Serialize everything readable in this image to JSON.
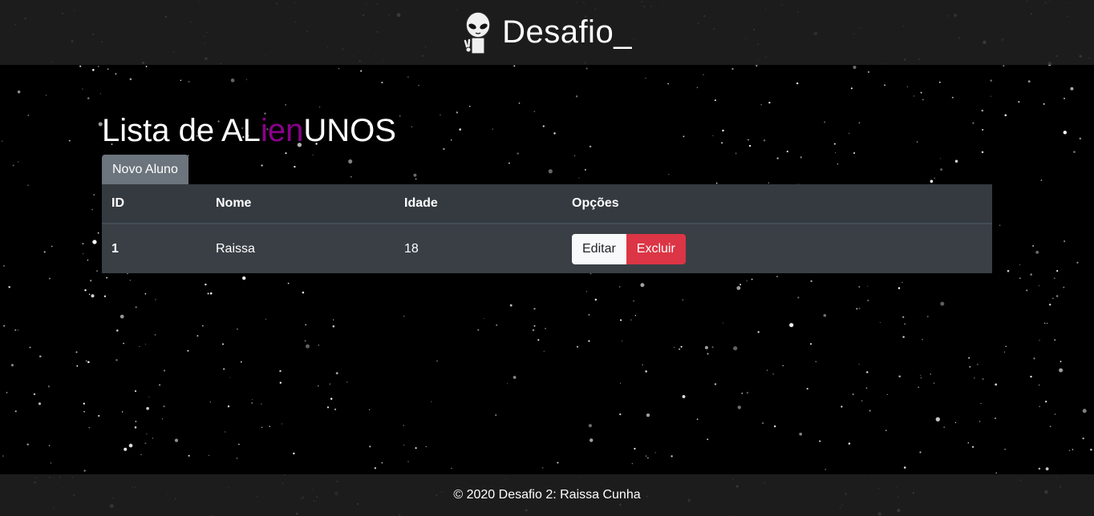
{
  "header": {
    "brand_icon": "alien-peace-icon",
    "brand_text": "Desafio_"
  },
  "page": {
    "title_prefix": "Lista de AL",
    "title_accent": "ien",
    "title_suffix": "UNOS",
    "accent_color": "#8b008b",
    "new_button_label": "Novo Aluno"
  },
  "table": {
    "headers": {
      "id": "ID",
      "nome": "Nome",
      "idade": "Idade",
      "opcoes": "Opções"
    },
    "rows": [
      {
        "id": "1",
        "nome": "Raissa",
        "idade": "18",
        "edit_label": "Editar",
        "delete_label": "Excluir"
      }
    ]
  },
  "footer": {
    "text": "© 2020 Desafio 2: Raissa Cunha"
  },
  "colors": {
    "background": "#000000",
    "bar": "#202020",
    "table": "#343a40",
    "secondary_button": "#6c757d",
    "danger_button": "#dc3545",
    "light_button": "#f8f9fa"
  }
}
